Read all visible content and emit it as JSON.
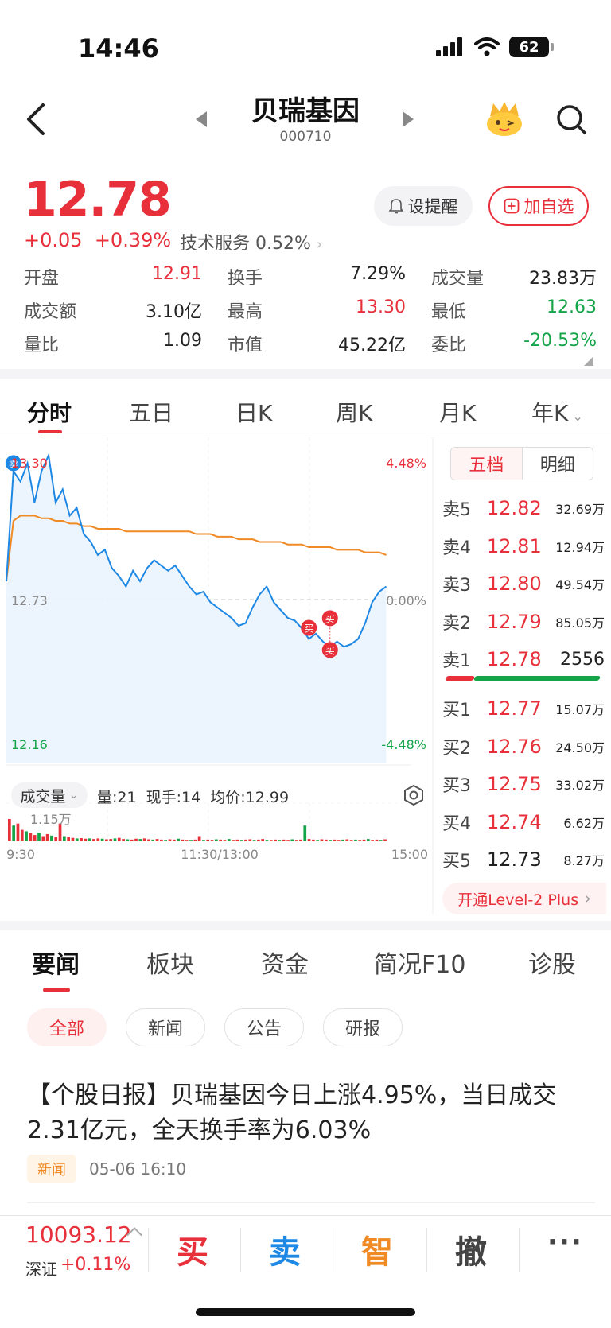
{
  "status_bar": {
    "time": "14:46",
    "battery": "62"
  },
  "header": {
    "title": "贝瑞基因",
    "code": "000710"
  },
  "quote": {
    "price": "12.78",
    "change": "+0.05",
    "change_pct": "+0.39%",
    "sector": "技术服务 0.52%",
    "alert_button": "设提醒",
    "add_button": "加自选"
  },
  "stats": [
    {
      "label": "开盘",
      "value": "12.91",
      "color": "#e8303b"
    },
    {
      "label": "换手",
      "value": "7.29%",
      "color": "#222222"
    },
    {
      "label": "成交量",
      "value": "23.83万",
      "color": "#222222"
    },
    {
      "label": "成交额",
      "value": "3.10亿",
      "color": "#222222"
    },
    {
      "label": "最高",
      "value": "13.30",
      "color": "#e8303b"
    },
    {
      "label": "最低",
      "value": "12.63",
      "color": "#14a548"
    },
    {
      "label": "量比",
      "value": "1.09",
      "color": "#222222"
    },
    {
      "label": "市值",
      "value": "45.22亿",
      "color": "#222222"
    },
    {
      "label": "委比",
      "value": "-20.53%",
      "color": "#14a548"
    }
  ],
  "chart_tabs": [
    "分时",
    "五日",
    "日K",
    "周K",
    "月K",
    "年K"
  ],
  "chart_data": {
    "type": "line",
    "y_ticks_left": [
      "13.30",
      "12.73",
      "12.16"
    ],
    "y_ticks_right": [
      "4.48%",
      "0.00%",
      "-4.48%"
    ],
    "x_ticks": [
      "9:30",
      "11:30/13:00",
      "15:00"
    ],
    "ylim": [
      12.16,
      13.3
    ],
    "prev_close": 12.73,
    "series": [
      {
        "color": "#1e88e5",
        "values": [
          12.8,
          13.22,
          13.18,
          13.25,
          13.1,
          13.22,
          13.28,
          13.1,
          13.15,
          13.05,
          13.08,
          12.98,
          12.95,
          12.9,
          12.92,
          12.85,
          12.82,
          12.78,
          12.84,
          12.8,
          12.85,
          12.88,
          12.86,
          12.84,
          12.86,
          12.82,
          12.78,
          12.75,
          12.76,
          12.72,
          12.7,
          12.68,
          12.66,
          12.63,
          12.64,
          12.7,
          12.75,
          12.78,
          12.72,
          12.69,
          12.66,
          12.65,
          12.62,
          12.58,
          12.6,
          12.57,
          12.55,
          12.57,
          12.55,
          12.56,
          12.58,
          12.64,
          12.72,
          12.76,
          12.78
        ]
      },
      {
        "color": "#f08a24",
        "values": [
          12.8,
          13.03,
          13.05,
          13.05,
          13.05,
          13.04,
          13.04,
          13.03,
          13.03,
          13.02,
          13.02,
          13.01,
          13.01,
          13.0,
          13.0,
          13.0,
          13.0,
          12.99,
          12.99,
          12.99,
          12.99,
          12.99,
          12.99,
          12.99,
          12.99,
          12.99,
          12.99,
          12.98,
          12.98,
          12.98,
          12.97,
          12.97,
          12.97,
          12.96,
          12.96,
          12.96,
          12.95,
          12.95,
          12.95,
          12.95,
          12.94,
          12.94,
          12.94,
          12.93,
          12.93,
          12.93,
          12.93,
          12.92,
          12.92,
          12.92,
          12.92,
          12.91,
          12.91,
          12.91,
          12.9
        ]
      }
    ],
    "trade_markers": [
      "卖",
      "买",
      "买",
      "买"
    ],
    "volume": {
      "max_label": "1.15万",
      "values": [
        0.78,
        0.55,
        0.62,
        0.4,
        0.35,
        0.28,
        0.22,
        0.3,
        0.18,
        0.25,
        0.2,
        0.15,
        0.62,
        0.18,
        0.14,
        0.12,
        0.1,
        0.11,
        0.09,
        0.1,
        0.08,
        0.1,
        0.09,
        0.07,
        0.08,
        0.1,
        0.12,
        0.08,
        0.07,
        0.06,
        0.09,
        0.08,
        0.1,
        0.07,
        0.06,
        0.08,
        0.06,
        0.05,
        0.07,
        0.06,
        0.09,
        0.06,
        0.05,
        0.05,
        0.06,
        0.18,
        0.05,
        0.06,
        0.05,
        0.07,
        0.06,
        0.05,
        0.08,
        0.05,
        0.06,
        0.05,
        0.06,
        0.07,
        0.05,
        0.06,
        0.08,
        0.05,
        0.05,
        0.06,
        0.05,
        0.06,
        0.05,
        0.07,
        0.05,
        0.06,
        0.55,
        0.08,
        0.06,
        0.05,
        0.07,
        0.06,
        0.05,
        0.06,
        0.05,
        0.06,
        0.07,
        0.05,
        0.06,
        0.05,
        0.06,
        0.08,
        0.05,
        0.06,
        0.05,
        0.07
      ]
    }
  },
  "volume_header": {
    "dropdown": "成交量",
    "info": "量:21 现手:14 均价:12.99"
  },
  "order_book": {
    "tabs": [
      "五档",
      "明细"
    ],
    "asks": [
      {
        "label": "卖5",
        "price": "12.82",
        "vol": "32.69万",
        "color": "#e8303b"
      },
      {
        "label": "卖4",
        "price": "12.81",
        "vol": "12.94万",
        "color": "#e8303b"
      },
      {
        "label": "卖3",
        "price": "12.80",
        "vol": "49.54万",
        "color": "#e8303b"
      },
      {
        "label": "卖2",
        "price": "12.79",
        "vol": "85.05万",
        "color": "#e8303b"
      },
      {
        "label": "卖1",
        "price": "12.78",
        "vol": "2556",
        "color": "#e8303b"
      }
    ],
    "bids": [
      {
        "label": "买1",
        "price": "12.77",
        "vol": "15.07万",
        "color": "#e8303b"
      },
      {
        "label": "买2",
        "price": "12.76",
        "vol": "24.50万",
        "color": "#e8303b"
      },
      {
        "label": "买3",
        "price": "12.75",
        "vol": "33.02万",
        "color": "#e8303b"
      },
      {
        "label": "买4",
        "price": "12.74",
        "vol": "6.62万",
        "color": "#e8303b"
      },
      {
        "label": "买5",
        "price": "12.73",
        "vol": "8.27万",
        "color": "#222222"
      }
    ],
    "level2": "开通Level-2 Plus"
  },
  "news_tabs": [
    "要闻",
    "板块",
    "资金",
    "简况F10",
    "诊股"
  ],
  "news_chips": [
    "全部",
    "新闻",
    "公告",
    "研报"
  ],
  "news_item": {
    "title": "【个股日报】贝瑞基因今日上涨4.95%，当日成交2.31亿元，全天换手率为6.03%",
    "tag": "新闻",
    "time": "05-06 16:10"
  },
  "bottom_bar": {
    "index_value": "10093.12",
    "index_name": "深证",
    "index_change": "+0.11%",
    "buy": "买",
    "sell": "卖",
    "smart": "智",
    "cancel": "撤",
    "more": "···"
  }
}
